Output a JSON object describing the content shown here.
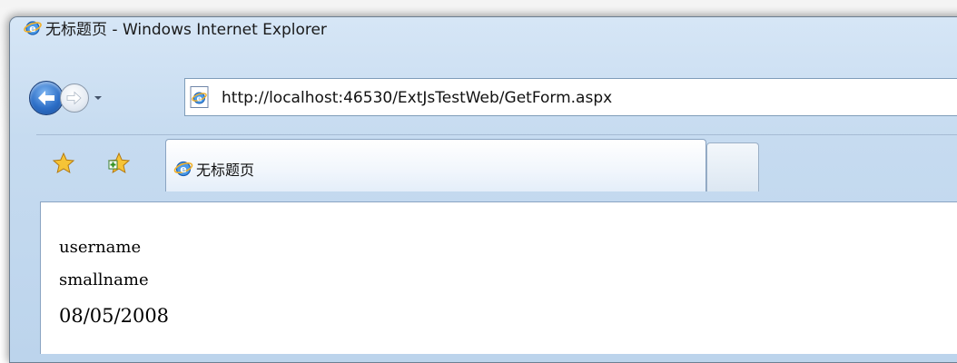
{
  "window": {
    "title": "无标题页 - Windows Internet Explorer"
  },
  "navigation": {
    "back_icon": "back-arrow-icon",
    "forward_icon": "forward-arrow-icon",
    "recent_pages_icon": "chevron-down-icon",
    "address_url": "http://localhost:46530/ExtJsTestWeb/GetForm.aspx",
    "address_icon": "ie-page-icon"
  },
  "toolbar": {
    "favorites_icon": "star-icon",
    "add_favorites_icon": "add-favorite-icon"
  },
  "tabs": [
    {
      "label": "无标题页",
      "icon": "ie-logo-icon",
      "active": true
    },
    {
      "label": "",
      "icon": "new-tab-icon",
      "active": false
    }
  ],
  "page": {
    "lines": [
      "username",
      "smallname",
      "08/05/2008"
    ]
  },
  "colors": {
    "frame": "#c6dbf0",
    "back_button": "#2d6fc7",
    "content_background": "#ffffff"
  }
}
